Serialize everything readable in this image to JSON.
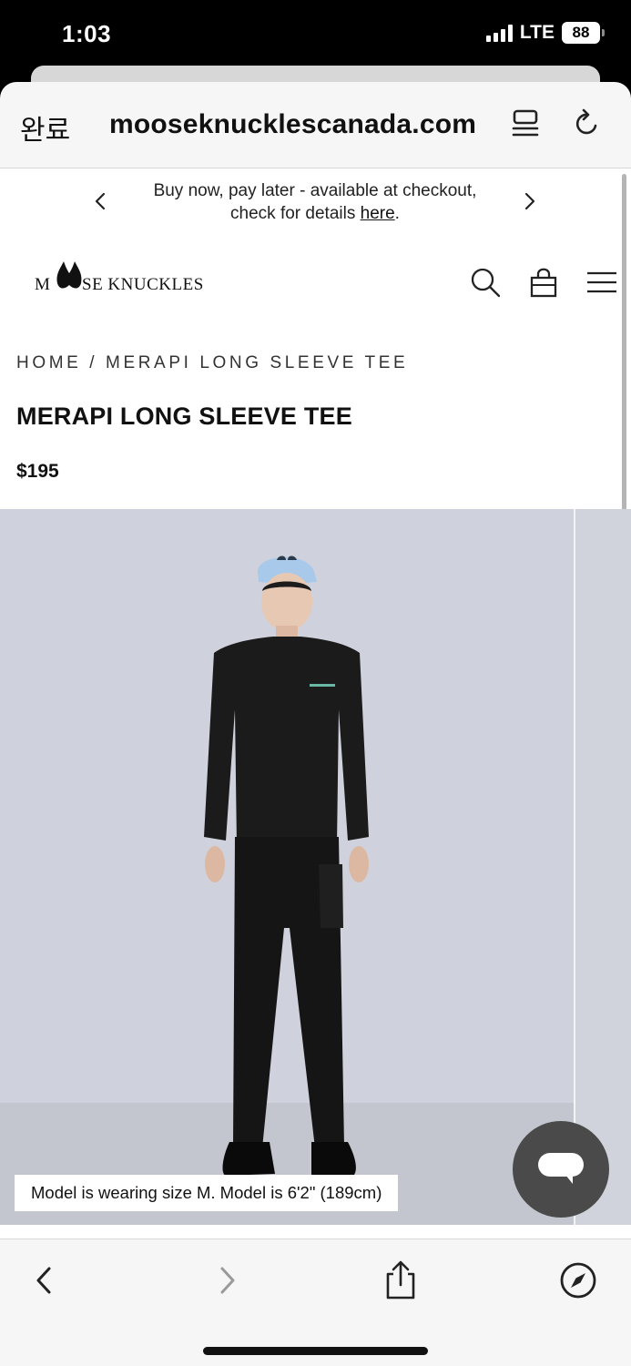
{
  "status_bar": {
    "time": "1:03",
    "network": "LTE",
    "battery": "88"
  },
  "browser": {
    "done_label": "완료",
    "url": "mooseknucklescanada.com",
    "icons": {
      "reader": "reader-mode-icon",
      "reload": "reload-icon"
    }
  },
  "promo": {
    "text": "Buy now, pay later - available at checkout, check for details ",
    "link": "here",
    "suffix": "."
  },
  "header": {
    "brand": "MOOSE KNUCKLES",
    "icons": [
      "search-icon",
      "bag-icon",
      "menu-icon"
    ]
  },
  "breadcrumb": "HOME / MERAPI LONG SLEEVE TEE",
  "product": {
    "title": "MERAPI LONG SLEEVE TEE",
    "price": "$195",
    "caption": "Model is wearing size M. Model is 6'2\" (189cm)"
  },
  "toolbar": {
    "icons": [
      "back-icon",
      "forward-icon",
      "share-icon",
      "compass-icon"
    ]
  },
  "colors": {
    "accent_text": "#111111",
    "gallery_bg": "#cfd2dc",
    "chat_button": "#4a4a4a",
    "cap": "#a9c9ea"
  }
}
